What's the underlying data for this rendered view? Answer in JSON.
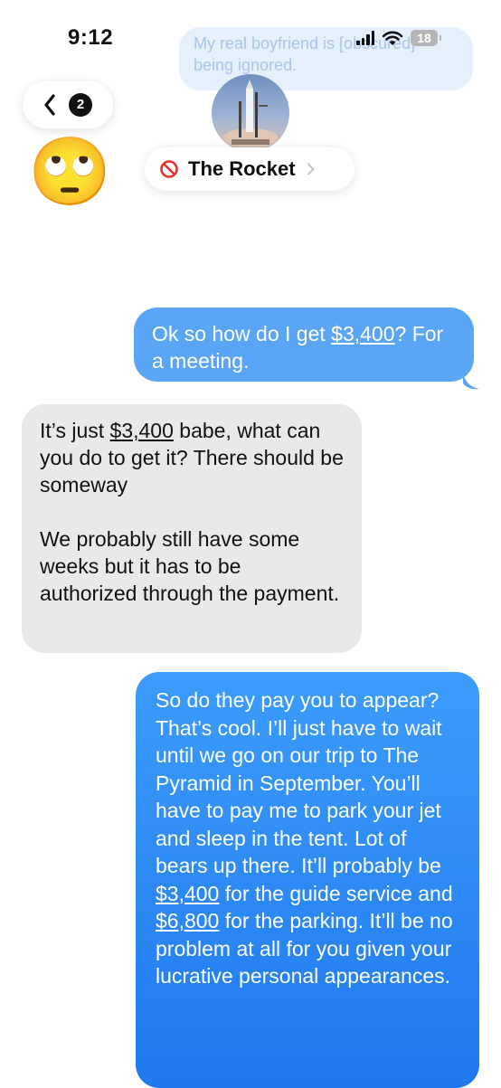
{
  "status_bar": {
    "time": "9:12",
    "battery": "18"
  },
  "overlay_notification": {
    "text": "My real boyfriend is [obscured] being ignored."
  },
  "header": {
    "back_count": "2",
    "reaction_emoji": "🙄",
    "contact_name": "The Rocket",
    "blocked": true
  },
  "messages": [
    {
      "direction": "sent",
      "parts": [
        "Ok so how do I get ",
        "$3,400",
        "? For a meeting."
      ]
    },
    {
      "direction": "received",
      "paragraphs": [
        [
          "It’s just ",
          "$3,400",
          " babe, what can you do to get it? There should be someway"
        ],
        [
          "We probably still have some weeks but it has to be authorized through the payment."
        ]
      ]
    },
    {
      "direction": "sent",
      "parts": [
        "So do they pay you to appear? That’s cool. I’ll just have to wait until we go on our trip to The Pyramid in September. You’ll have to pay me to park your jet and sleep in the tent. Lot of bears up there. It’ll probably be ",
        "$3,400",
        " for the guide service and ",
        "$6,800",
        " for the parking. It’ll be no problem at all for you given your lucrative personal appearances."
      ]
    }
  ],
  "colors": {
    "sent_top": "#3c9cfb",
    "sent_bottom": "#1f79ee",
    "sent_light": "#5aa5f5",
    "received": "#e9e9eb"
  }
}
